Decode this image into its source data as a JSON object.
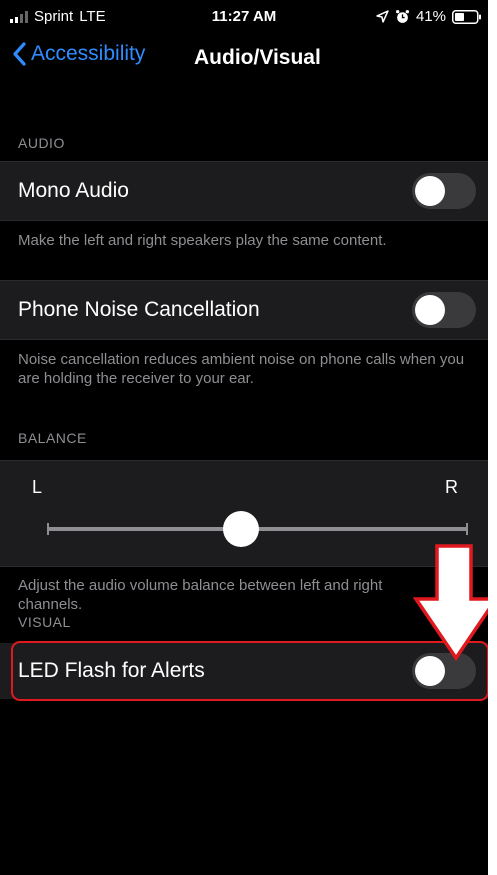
{
  "status_bar": {
    "carrier": "Sprint",
    "network": "LTE",
    "time": "11:27 AM",
    "battery": "41%",
    "icons": [
      "signal-icon",
      "location-icon",
      "alarm-icon",
      "battery-icon"
    ]
  },
  "nav": {
    "back_label": "Accessibility",
    "title": "Audio/Visual"
  },
  "audio": {
    "header": "AUDIO",
    "mono": {
      "label": "Mono Audio",
      "enabled": false,
      "footer": "Make the left and right speakers play the same content."
    },
    "noise": {
      "label": "Phone Noise Cancellation",
      "enabled": false,
      "footer": "Noise cancellation reduces ambient noise on phone calls when you are holding the receiver to your ear."
    }
  },
  "balance": {
    "header": "BALANCE",
    "left_label": "L",
    "right_label": "R",
    "value": 0.46,
    "footer": "Adjust the audio volume balance between left and right channels."
  },
  "visual": {
    "header": "VISUAL",
    "led_flash": {
      "label": "LED Flash for Alerts",
      "enabled": false
    }
  },
  "colors": {
    "accent": "#2f8cff",
    "highlight": "#e0191f",
    "background": "#000000",
    "cell": "#1c1c1e"
  }
}
